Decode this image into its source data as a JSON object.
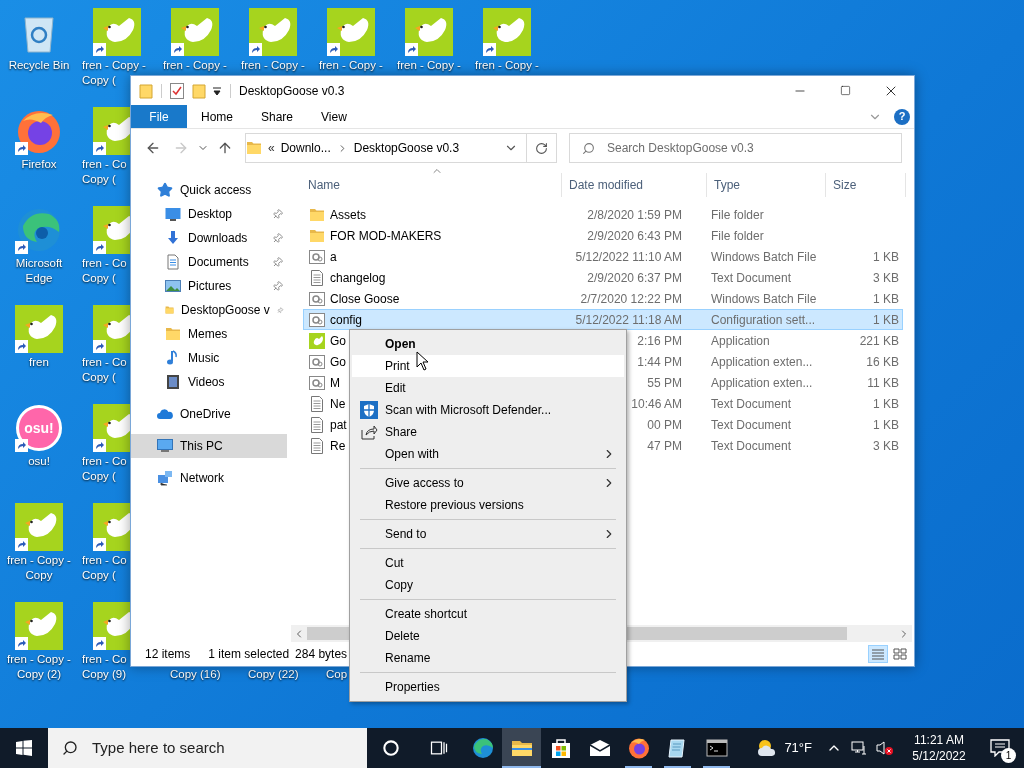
{
  "desktop": {
    "columns": [
      {
        "icons": [
          {
            "kind": "recycle-bin",
            "lines": [
              "Recycle Bin"
            ]
          },
          {
            "kind": "firefox",
            "lines": [
              "Firefox"
            ]
          },
          {
            "kind": "edge",
            "lines": [
              "Microsoft",
              "Edge"
            ]
          },
          {
            "kind": "goose",
            "lines": [
              "fren"
            ]
          },
          {
            "kind": "osu",
            "logo_text": "osu!",
            "lines": [
              "osu!"
            ]
          },
          {
            "kind": "goose",
            "lines": [
              "fren - Copy -",
              "Copy"
            ]
          },
          {
            "kind": "goose",
            "lines": [
              "fren - Copy -",
              "Copy (2)"
            ]
          }
        ]
      },
      {
        "icons": [
          {
            "kind": "goose",
            "lines": [
              "fren - Copy -",
              "Copy ("
            ]
          },
          {
            "kind": "goose",
            "lines": [
              "fren - Co",
              "Copy ("
            ]
          },
          {
            "kind": "goose",
            "lines": [
              "fren - Co",
              "Copy ("
            ]
          },
          {
            "kind": "goose",
            "lines": [
              "fren - Co",
              "Copy ("
            ]
          },
          {
            "kind": "goose",
            "lines": [
              "fren - Co",
              "Copy ("
            ]
          },
          {
            "kind": "goose",
            "lines": [
              "fren - Co",
              "Copy ("
            ]
          },
          {
            "kind": "goose",
            "lines": [
              "fren - Co",
              "Copy (9)"
            ]
          }
        ]
      },
      {
        "icons": [
          {
            "kind": "goose",
            "lines": [
              "fren - Copy -"
            ]
          },
          {
            "kind": "label-only",
            "lines": [
              "Copy (16)"
            ]
          }
        ]
      },
      {
        "icons": [
          {
            "kind": "goose",
            "lines": [
              "fren - Copy -"
            ]
          },
          {
            "kind": "label-only",
            "lines": [
              "Copy (22)"
            ]
          }
        ]
      },
      {
        "icons": [
          {
            "kind": "goose",
            "lines": [
              "fren - Copy -"
            ]
          },
          {
            "kind": "label-only",
            "lines": [
              "Cop"
            ]
          }
        ]
      },
      {
        "icons": [
          {
            "kind": "goose",
            "lines": [
              "fren - Copy -"
            ]
          }
        ]
      },
      {
        "icons": [
          {
            "kind": "goose",
            "lines": [
              "fren - Copy -"
            ]
          }
        ]
      }
    ]
  },
  "explorer": {
    "title": "DesktopGoose v0.3",
    "ribbon_tabs": [
      {
        "label": "File",
        "selected": true
      },
      {
        "label": "Home",
        "selected": false
      },
      {
        "label": "Share",
        "selected": false
      },
      {
        "label": "View",
        "selected": false
      }
    ],
    "help_label": "?",
    "nav_buttons": [
      {
        "kind": "back",
        "disabled": false
      },
      {
        "kind": "forward",
        "disabled": true
      },
      {
        "kind": "recent",
        "disabled": false
      },
      {
        "kind": "up",
        "disabled": false
      }
    ],
    "address": {
      "prefix": "«",
      "crumbs": [
        "Downlo...",
        "DesktopGoose v0.3"
      ]
    },
    "search": {
      "placeholder": "Search DesktopGoose v0.3"
    },
    "sidebar": {
      "items": [
        {
          "label": "Quick access",
          "kind": "star",
          "selected": false,
          "children": [
            {
              "label": "Desktop",
              "kind": "desktop",
              "pinned": true,
              "selected": false
            },
            {
              "label": "Downloads",
              "kind": "downloads",
              "pinned": true,
              "selected": false
            },
            {
              "label": "Documents",
              "kind": "documents",
              "pinned": true,
              "selected": false
            },
            {
              "label": "Pictures",
              "kind": "pictures",
              "pinned": true,
              "selected": false
            },
            {
              "label": "DesktopGoose v",
              "kind": "folder",
              "pinned": true,
              "selected": false
            },
            {
              "label": "Memes",
              "kind": "folder",
              "pinned": false,
              "selected": false
            },
            {
              "label": "Music",
              "kind": "music",
              "pinned": false,
              "selected": false
            },
            {
              "label": "Videos",
              "kind": "videos",
              "pinned": false,
              "selected": false
            }
          ]
        },
        {
          "label": "OneDrive",
          "kind": "onedrive",
          "selected": false
        },
        {
          "label": "This PC",
          "kind": "pc",
          "selected": true
        },
        {
          "label": "Network",
          "kind": "network",
          "selected": false
        }
      ]
    },
    "columns": [
      {
        "label": "Name",
        "sorted": true
      },
      {
        "label": "Date modified",
        "sorted": false
      },
      {
        "label": "Type",
        "sorted": false
      },
      {
        "label": "Size",
        "sorted": false
      }
    ],
    "rows": [
      {
        "kind": "folder",
        "name": "Assets",
        "date": "2/8/2020 1:59 PM",
        "type": "File folder",
        "selected": false
      },
      {
        "kind": "folder",
        "name": "FOR MOD-MAKERS",
        "date": "2/9/2020 6:43 PM",
        "type": "File folder",
        "selected": false
      },
      {
        "kind": "batch",
        "name": "a",
        "date": "5/12/2022 11:10 AM",
        "type": "Windows Batch File",
        "size": "1 KB",
        "selected": false
      },
      {
        "kind": "text",
        "name": "changelog",
        "date": "2/9/2020 6:37 PM",
        "type": "Text Document",
        "size": "3 KB",
        "selected": false
      },
      {
        "kind": "batch",
        "name": "Close Goose",
        "date": "2/7/2020 12:22 PM",
        "type": "Windows Batch File",
        "size": "1 KB",
        "selected": false
      },
      {
        "kind": "config",
        "name": "config",
        "date": "5/12/2022 11:18 AM",
        "type": "Configuration sett...",
        "size": "1 KB",
        "selected": true
      },
      {
        "kind": "app",
        "name": "Go",
        "date": "2:16 PM",
        "type": "Application",
        "size": "221 KB",
        "selected": false
      },
      {
        "kind": "dll",
        "name": "Go",
        "date": "1:44 PM",
        "type": "Application exten...",
        "size": "16 KB",
        "selected": false
      },
      {
        "kind": "dll",
        "name": "M",
        "date": "55 PM",
        "type": "Application exten...",
        "size": "11 KB",
        "selected": false
      },
      {
        "kind": "text",
        "name": "Ne",
        "date": "10:46 AM",
        "type": "Text Document",
        "size": "1 KB",
        "selected": false
      },
      {
        "kind": "text",
        "name": "pat",
        "date": "00 PM",
        "type": "Text Document",
        "size": "1 KB",
        "selected": false
      },
      {
        "kind": "text",
        "name": "Re",
        "date": "47 PM",
        "type": "Text Document",
        "size": "3 KB",
        "selected": false
      }
    ],
    "status": {
      "count": "12 items",
      "selection": "1 item selected",
      "size": "284 bytes"
    },
    "views": [
      {
        "kind": "details",
        "selected": true
      },
      {
        "kind": "tiles",
        "selected": false
      }
    ]
  },
  "context_menu": {
    "groups": [
      [
        {
          "kind": "plain",
          "label": "Open",
          "default": true,
          "selected": false,
          "submenu": false
        },
        {
          "kind": "plain",
          "label": "Print",
          "default": false,
          "selected": true,
          "submenu": false
        },
        {
          "kind": "plain",
          "label": "Edit",
          "default": false,
          "selected": false,
          "submenu": false
        },
        {
          "kind": "scan",
          "label": "Scan with Microsoft Defender...",
          "default": false,
          "selected": false,
          "submenu": false
        },
        {
          "kind": "share",
          "label": "Share",
          "default": false,
          "selected": false,
          "submenu": false
        },
        {
          "kind": "plain",
          "label": "Open with",
          "default": false,
          "selected": false,
          "submenu": true
        }
      ],
      [
        {
          "kind": "plain",
          "label": "Give access to",
          "default": false,
          "selected": false,
          "submenu": true
        },
        {
          "kind": "plain",
          "label": "Restore previous versions",
          "default": false,
          "selected": false,
          "submenu": false
        }
      ],
      [
        {
          "kind": "plain",
          "label": "Send to",
          "default": false,
          "selected": false,
          "submenu": true
        }
      ],
      [
        {
          "kind": "plain",
          "label": "Cut",
          "default": false,
          "selected": false,
          "submenu": false
        },
        {
          "kind": "plain",
          "label": "Copy",
          "default": false,
          "selected": false,
          "submenu": false
        }
      ],
      [
        {
          "kind": "plain",
          "label": "Create shortcut",
          "default": false,
          "selected": false,
          "submenu": false
        },
        {
          "kind": "plain",
          "label": "Delete",
          "default": false,
          "selected": false,
          "submenu": false
        },
        {
          "kind": "plain",
          "label": "Rename",
          "default": false,
          "selected": false,
          "submenu": false
        }
      ],
      [
        {
          "kind": "plain",
          "label": "Properties",
          "default": false,
          "selected": false,
          "submenu": false
        }
      ]
    ]
  },
  "taskbar": {
    "search_placeholder": "Type here to search",
    "apps": [
      {
        "kind": "cortana",
        "active": false,
        "running": false
      },
      {
        "kind": "taskview",
        "active": false,
        "running": false
      },
      {
        "kind": "edge",
        "active": false,
        "running": false
      },
      {
        "kind": "explorer",
        "active": true,
        "running": true
      },
      {
        "kind": "store",
        "active": false,
        "running": false
      },
      {
        "kind": "mail",
        "active": false,
        "running": false
      },
      {
        "kind": "firefox",
        "active": false,
        "running": true
      },
      {
        "kind": "notepad",
        "active": false,
        "running": true
      },
      {
        "kind": "terminal",
        "active": false,
        "running": true
      }
    ],
    "weather": "71°F",
    "time": "11:21 AM",
    "date": "5/12/2022",
    "notifications": "1"
  }
}
